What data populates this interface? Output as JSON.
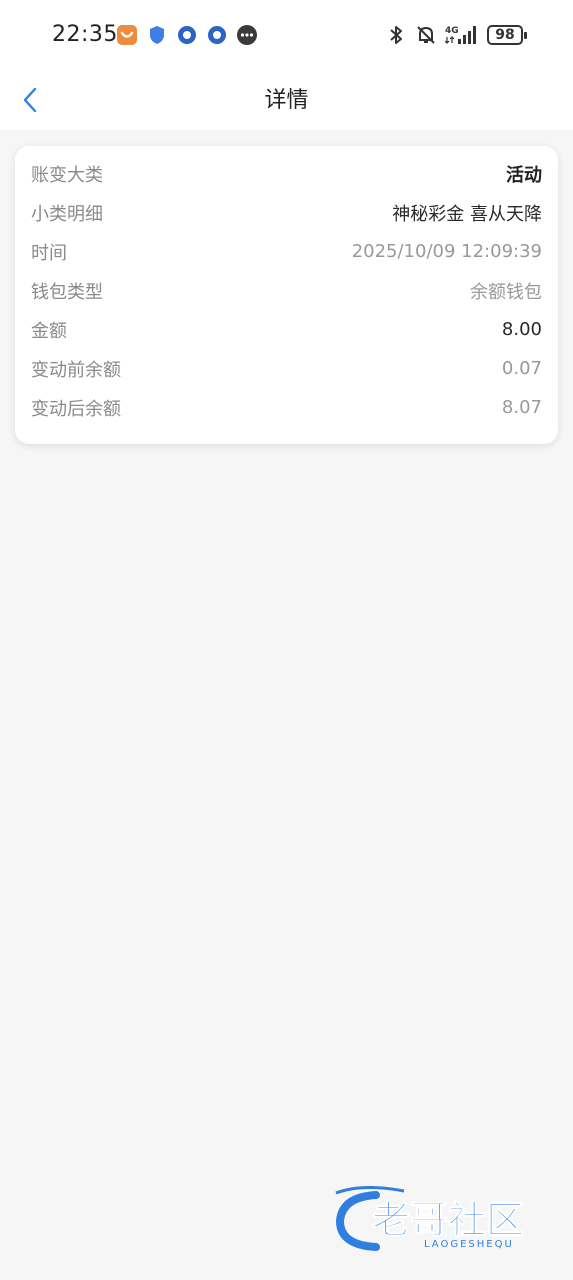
{
  "status_bar": {
    "time": "22:35",
    "network": "4G",
    "battery": "98",
    "icons_left": [
      "app-badge-icon",
      "shield-icon",
      "circle-app-icon",
      "circle-app-icon",
      "chat-bubble-icon"
    ],
    "icons_right": [
      "bluetooth-icon",
      "mute-bell-icon",
      "signal-icon",
      "battery-icon"
    ]
  },
  "header": {
    "title": "详情",
    "back_icon": "chevron-left-icon"
  },
  "details": {
    "rows": [
      {
        "label": "账变大类",
        "value": "活动"
      },
      {
        "label": "小类明细",
        "value": "神秘彩金 喜从天降"
      },
      {
        "label": "时间",
        "value": "2025/10/09 12:09:39"
      },
      {
        "label": "钱包类型",
        "value": "余额钱包"
      },
      {
        "label": "金额",
        "value": "8.00"
      },
      {
        "label": "变动前余额",
        "value": "0.07"
      },
      {
        "label": "变动后余额",
        "value": "8.07"
      }
    ]
  },
  "watermark": {
    "text": "老哥社区",
    "subtext": "LAOGESHEQU",
    "color": "#2f7fe0"
  },
  "colors": {
    "accent": "#2f7fe0",
    "background": "#f6f6f6"
  }
}
